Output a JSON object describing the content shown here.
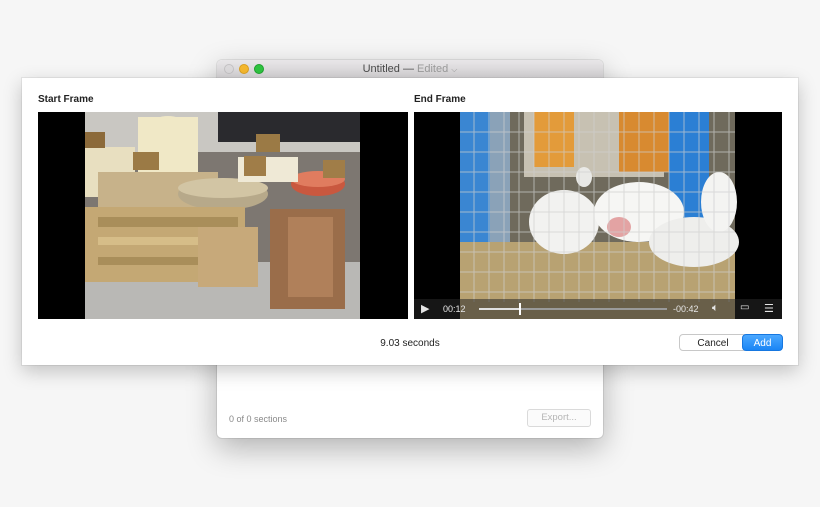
{
  "window": {
    "title": "Untitled",
    "separator": "—",
    "edited": "Edited",
    "sections_text": "0 of 0 sections",
    "export_label": "Export..."
  },
  "sheet": {
    "start_label": "Start Frame",
    "end_label": "End Frame",
    "duration": "9.03 seconds",
    "cancel_label": "Cancel",
    "add_label": "Add"
  },
  "player": {
    "elapsed": "00:12",
    "remaining": "-00:42",
    "progress": 0.22
  },
  "colors": {
    "accent": "#1a85f5",
    "close": "#dcdadc",
    "minimize": "#f5b82e",
    "zoom": "#2ec440"
  }
}
